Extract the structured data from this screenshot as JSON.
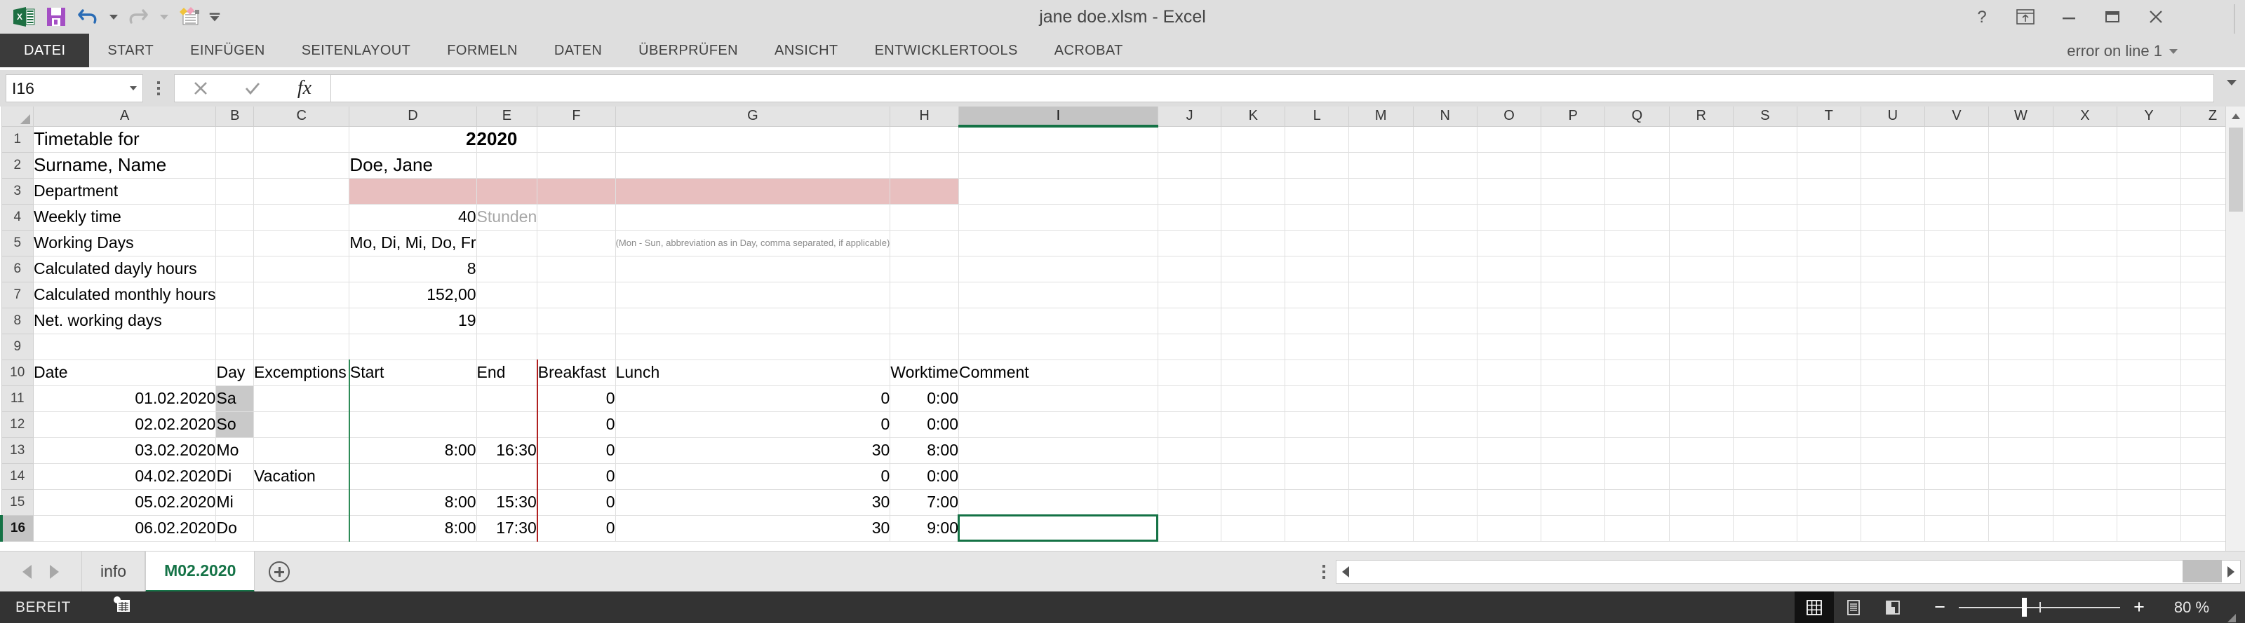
{
  "window": {
    "title": "jane doe.xlsm - Excel",
    "help_icon": "question-mark-icon",
    "ribbon_display_icon": "ribbon-display-options-icon",
    "minimize_icon": "minimize-icon",
    "restore_icon": "restore-icon",
    "close_icon": "close-icon"
  },
  "quick_access": {
    "app_icon": "excel-app-icon",
    "save_label": "save-icon",
    "undo_label": "undo-icon",
    "redo_label": "redo-icon",
    "touch_label": "new-comment-icon",
    "customize_label": "customize-quick-access-icon"
  },
  "account": {
    "label": "error on line 1",
    "avatar": "user-avatar"
  },
  "ribbon": {
    "tabs": [
      {
        "label": "DATEI",
        "active": true
      },
      {
        "label": "START",
        "active": false
      },
      {
        "label": "EINFÜGEN",
        "active": false
      },
      {
        "label": "SEITENLAYOUT",
        "active": false
      },
      {
        "label": "FORMELN",
        "active": false
      },
      {
        "label": "DATEN",
        "active": false
      },
      {
        "label": "ÜBERPRÜFEN",
        "active": false
      },
      {
        "label": "ANSICHT",
        "active": false
      },
      {
        "label": "ENTWICKLERTOOLS",
        "active": false
      },
      {
        "label": "ACROBAT",
        "active": false
      }
    ]
  },
  "formula_bar": {
    "name_box_value": "I16",
    "cancel_icon": "cancel-icon",
    "confirm_icon": "confirm-icon",
    "function_icon": "insert-function-icon",
    "formula_value": "",
    "expand_icon": "expand-formula-bar-icon"
  },
  "grid": {
    "selected_cell": "I16",
    "selected_column": "I",
    "selected_row": "16",
    "columns": [
      "A",
      "B",
      "C",
      "D",
      "E",
      "F",
      "G",
      "H",
      "I",
      "J",
      "K",
      "L",
      "M",
      "N",
      "O",
      "P",
      "Q",
      "R",
      "S",
      "T",
      "U",
      "V",
      "W",
      "X",
      "Y",
      "Z"
    ],
    "rows": [
      "1",
      "2",
      "3",
      "4",
      "5",
      "6",
      "7",
      "8",
      "9",
      "10",
      "11",
      "12",
      "13",
      "14",
      "15",
      "16"
    ],
    "cells": {
      "r1": {
        "A": "Timetable for",
        "D": "2",
        "E": "2020"
      },
      "r2": {
        "A": "Surname, Name",
        "D": "Doe, Jane"
      },
      "r3": {
        "A": "Department"
      },
      "r4": {
        "A": "Weekly time",
        "D": "40",
        "E": "Stunden"
      },
      "r5": {
        "A": "Working Days",
        "D": "Mo, Di, Mi, Do, Fr",
        "G": "(Mon - Sun, abbreviation as in Day, comma separated, if applicable)"
      },
      "r6": {
        "A": "Calculated dayly hours",
        "D": "8"
      },
      "r7": {
        "A": "Calculated monthly hours",
        "D": "152,00"
      },
      "r8": {
        "A": "Net. working days",
        "D": "19"
      },
      "r9": {},
      "r10": {
        "A": "Date",
        "B": "Day",
        "C": "Excemptions",
        "D": "Start",
        "E": "End",
        "F": "Breakfast",
        "G": "Lunch",
        "H": "Worktime",
        "I": "Comment"
      },
      "r11": {
        "A": "01.02.2020",
        "B": "Sa",
        "C": "",
        "D": "",
        "E": "",
        "F": "0",
        "G": "0",
        "H": "0:00",
        "I": ""
      },
      "r12": {
        "A": "02.02.2020",
        "B": "So",
        "C": "",
        "D": "",
        "E": "",
        "F": "0",
        "G": "0",
        "H": "0:00",
        "I": ""
      },
      "r13": {
        "A": "03.02.2020",
        "B": "Mo",
        "C": "",
        "D": "8:00",
        "E": "16:30",
        "F": "0",
        "G": "30",
        "H": "8:00",
        "I": ""
      },
      "r14": {
        "A": "04.02.2020",
        "B": "Di",
        "C": "Vacation",
        "D": "",
        "E": "",
        "F": "0",
        "G": "0",
        "H": "0:00",
        "I": ""
      },
      "r15": {
        "A": "05.02.2020",
        "B": "Mi",
        "C": "",
        "D": "8:00",
        "E": "15:30",
        "F": "0",
        "G": "30",
        "H": "7:00",
        "I": ""
      },
      "r16": {
        "A": "06.02.2020",
        "B": "Do",
        "C": "",
        "D": "8:00",
        "E": "17:30",
        "F": "0",
        "G": "30",
        "H": "9:00",
        "I": ""
      }
    },
    "colors": {
      "department_highlight": "#e8bfbf",
      "weekend_shade": "#c9c9c9",
      "selection_green": "#147245",
      "start_border": "#2e8b57",
      "end_border": "#b02020"
    }
  },
  "sheet_tabs": {
    "prev_icon": "previous-sheet-icon",
    "next_icon": "next-sheet-icon",
    "tabs": [
      {
        "label": "info",
        "active": false
      },
      {
        "label": "M02.2020",
        "active": true
      }
    ],
    "add_label": "add-sheet-icon"
  },
  "status_bar": {
    "state": "BEREIT",
    "macro_icon": "record-macro-icon",
    "view_normal_icon": "normal-view-icon",
    "view_layout_icon": "page-layout-view-icon",
    "view_break_icon": "page-break-preview-icon",
    "zoom_out": "−",
    "zoom_in": "+",
    "zoom_level": "80 %"
  }
}
